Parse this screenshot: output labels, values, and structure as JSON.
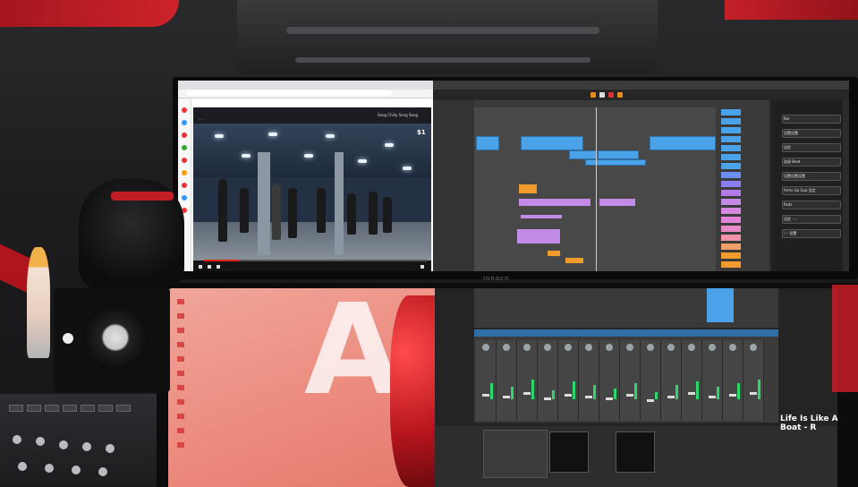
{
  "scene": "photo of dual-monitor music production desk",
  "top_monitor": {
    "brand": "innocn",
    "browser": {
      "video_title": "Song Chilly Song Song",
      "watermark": "$1",
      "channel": "• ---"
    },
    "daw": {
      "sidebar_items": [
        "Bar",
        "设置设置",
        "设定",
        "连接 Beat",
        "设置设置设置",
        "Arms Ga Gua 设定",
        "Pads",
        "设定 · ··",
        "···· 设置"
      ]
    }
  },
  "bottom_monitor": {
    "wallpaper_letter": "A",
    "daw_status_text": "Life Is Like A Boat - R"
  },
  "colors": {
    "accent_red": "#e0232b",
    "clip_blue": "#4aa3e8",
    "clip_purple": "#c38be6",
    "daw_orange": "#f19a2e",
    "meter_green": "#2fd66b"
  }
}
